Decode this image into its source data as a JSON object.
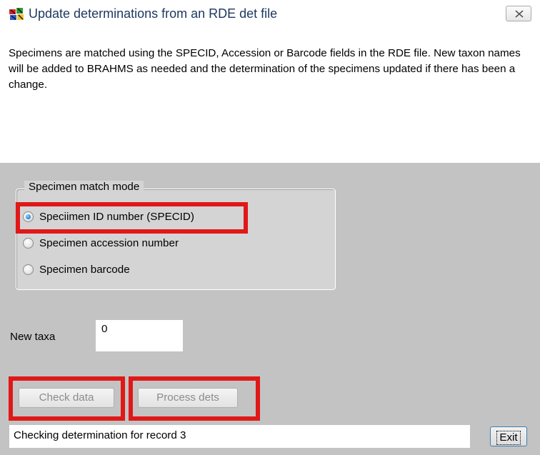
{
  "window": {
    "title": "Update determinations from an RDE det file",
    "app_icon": "brahms-app-icon",
    "close_icon": "close-icon"
  },
  "description": "Specimens are matched using the SPECID, Accession or Barcode fields in the RDE file. New taxon names will be added to BRAHMS as needed and the determination of the specimens updated if there has been a change.",
  "match_mode": {
    "legend": "Specimen match mode",
    "options": [
      {
        "label": "Speciimen ID number (SPECID)",
        "checked": true
      },
      {
        "label": "Specimen accession number",
        "checked": false
      },
      {
        "label": "Specimen barcode",
        "checked": false
      }
    ]
  },
  "new_taxa": {
    "label": "New taxa",
    "value": "0"
  },
  "buttons": {
    "check_data": "Check data",
    "process_dets": "Process dets",
    "exit": "Exit"
  },
  "status": "Checking determination for record 3",
  "colors": {
    "highlight": "#e01818",
    "form_background": "#c3c3c3",
    "title_text": "#1e3960"
  }
}
